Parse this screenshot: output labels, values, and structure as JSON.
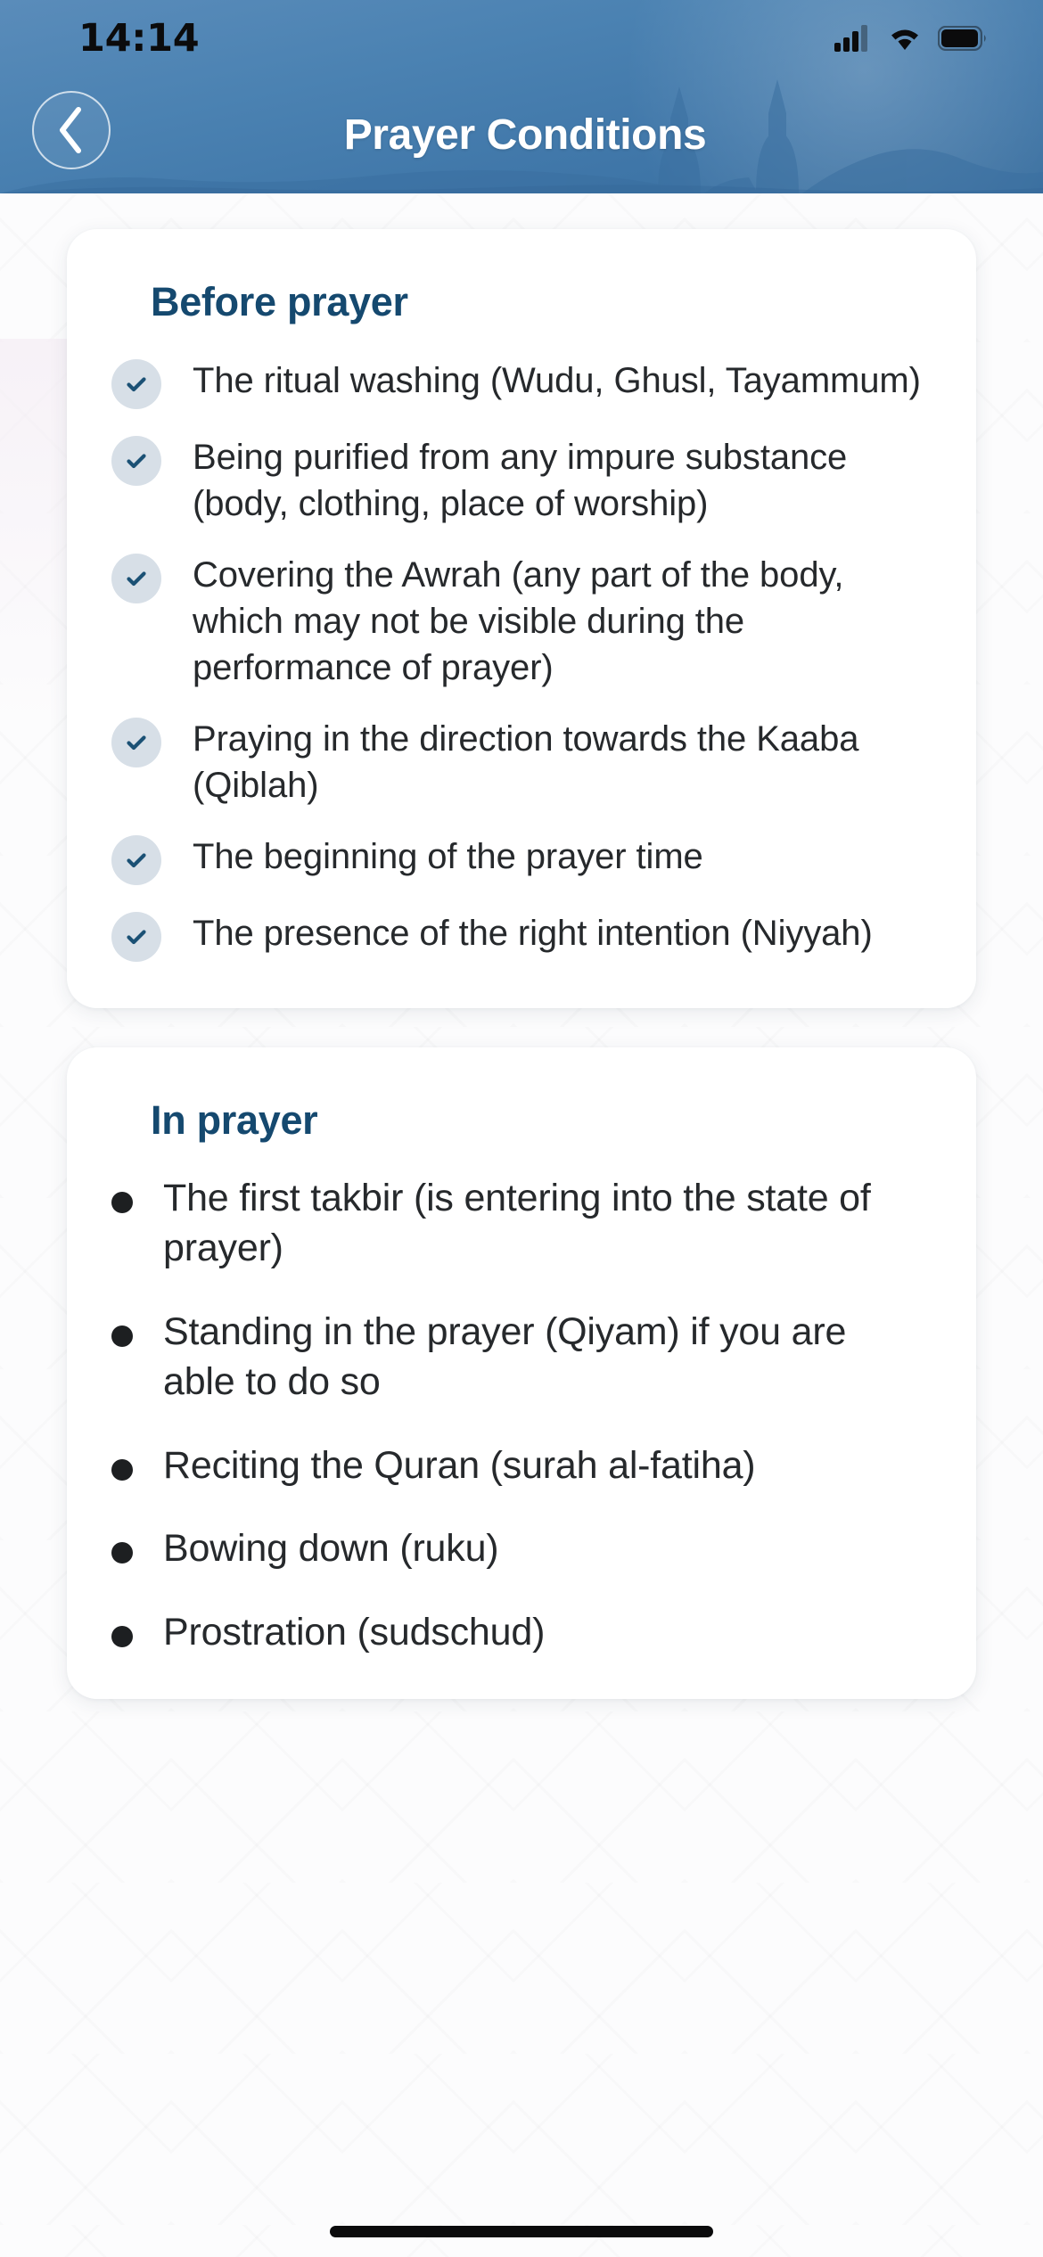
{
  "status_bar": {
    "time": "14:14",
    "icons": [
      "cellular-signal-icon",
      "wifi-icon",
      "battery-icon"
    ]
  },
  "header": {
    "title": "Prayer Conditions",
    "back_icon": "chevron-left-icon",
    "background_color": "#3f76a8"
  },
  "theme": {
    "accent": "#15496f",
    "header_blue": "#3f76a8",
    "check_badge_bg": "#d7dfe7",
    "check_mark": "#1b5175",
    "card_bg": "#ffffff",
    "body_text": "#26292c"
  },
  "cards": [
    {
      "title": "Before prayer",
      "marker": "check",
      "items": [
        "The ritual washing (Wudu, Ghusl, Tayammum)",
        "Being purified from any impure substance (body, clothing, place of worship)",
        "Covering the Awrah (any part of the body, which may not be visible during the performance of prayer)",
        "Praying in the direction towards the Kaaba (Qiblah)",
        "The beginning of the prayer time",
        "The presence of the right intention (Niyyah)"
      ]
    },
    {
      "title": "In prayer",
      "marker": "bullet",
      "items": [
        "The first takbir (is entering into the state of prayer)",
        "Standing in the prayer (Qiyam) if you are able to do so",
        "Reciting the Quran (surah al-fatiha)",
        "Bowing down (ruku)",
        "Prostration (sudschud)"
      ]
    }
  ]
}
